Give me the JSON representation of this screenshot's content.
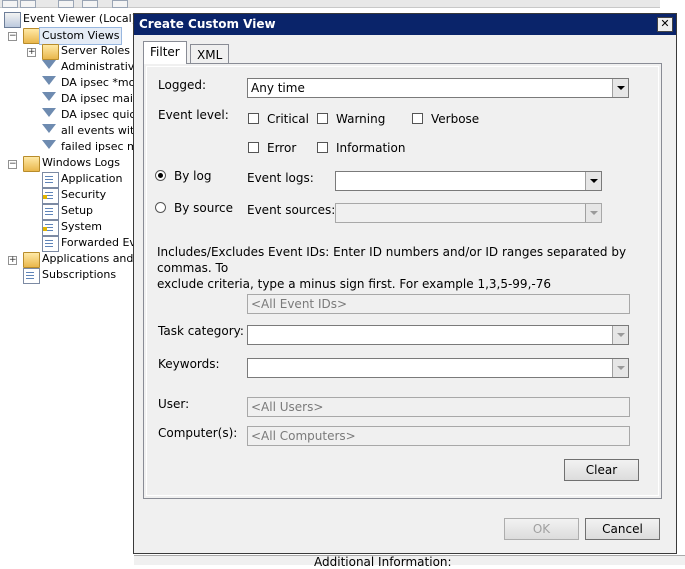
{
  "event_viewer": {
    "tree": [
      {
        "label": "Event Viewer (Local)",
        "icon": "event-viewer-icon"
      },
      {
        "label": "Custom Views",
        "icon": "folder-icon",
        "selected": true
      },
      {
        "label": "Server Roles",
        "icon": "folder-icon"
      },
      {
        "label": "Administrative",
        "icon": "filter-icon"
      },
      {
        "label": "DA ipsec  *mod",
        "icon": "filter-icon"
      },
      {
        "label": "DA ipsec main m",
        "icon": "filter-icon"
      },
      {
        "label": "DA ipsec quick&",
        "icon": "filter-icon"
      },
      {
        "label": "all events with",
        "icon": "filter-icon"
      },
      {
        "label": "failed ipsec mo",
        "icon": "filter-icon"
      },
      {
        "label": "Windows Logs",
        "icon": "folder-icon"
      },
      {
        "label": "Application",
        "icon": "log-icon"
      },
      {
        "label": "Security",
        "icon": "log-icon"
      },
      {
        "label": "Setup",
        "icon": "log-icon"
      },
      {
        "label": "System",
        "icon": "log-icon"
      },
      {
        "label": "Forwarded Eve",
        "icon": "log-icon"
      },
      {
        "label": "Applications and Se",
        "icon": "folder-icon"
      },
      {
        "label": "Subscriptions",
        "icon": "subscriptions-icon"
      }
    ],
    "bottom_text": "Additional Information:"
  },
  "dialog": {
    "title": "Create Custom View",
    "close_glyph": "✕",
    "tabs": [
      {
        "label": "Filter",
        "active": true
      },
      {
        "label": "XML",
        "active": false
      }
    ],
    "logged": {
      "label": "Logged:",
      "value": "Any time"
    },
    "event_level": {
      "label": "Event level:",
      "options": [
        {
          "label": "Critical",
          "checked": false
        },
        {
          "label": "Warning",
          "checked": false
        },
        {
          "label": "Verbose",
          "checked": false
        },
        {
          "label": "Error",
          "checked": false
        },
        {
          "label": "Information",
          "checked": false
        }
      ]
    },
    "by_log": {
      "label": "By log",
      "selected": true,
      "field_label": "Event logs:",
      "value": ""
    },
    "by_source": {
      "label": "By source",
      "selected": false,
      "field_label": "Event sources:",
      "value": ""
    },
    "event_ids_help": [
      "Includes/Excludes Event IDs: Enter ID numbers and/or ID ranges separated by commas. To",
      "exclude criteria, type a minus sign first. For example 1,3,5-99,-76"
    ],
    "event_ids_placeholder": "<All Event IDs>",
    "task_category": {
      "label": "Task category:",
      "value": ""
    },
    "keywords": {
      "label": "Keywords:",
      "value": ""
    },
    "user": {
      "label": "User:",
      "placeholder": "<All Users>"
    },
    "computers": {
      "label": "Computer(s):",
      "placeholder": "<All Computers>"
    },
    "clear_label": "Clear",
    "ok_label": "OK",
    "cancel_label": "Cancel"
  }
}
